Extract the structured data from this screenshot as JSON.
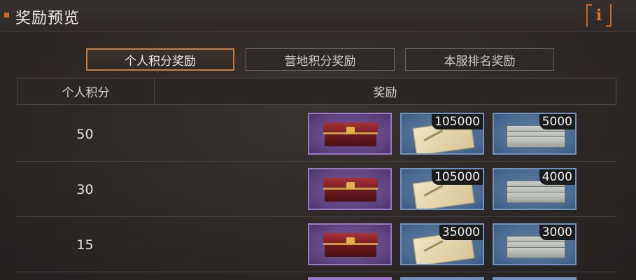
{
  "header": {
    "title": "奖励预览",
    "info_label": "i"
  },
  "tabs": [
    {
      "label": "个人积分奖励",
      "active": true
    },
    {
      "label": "营地积分奖励",
      "active": false
    },
    {
      "label": "本服排名奖励",
      "active": false
    }
  ],
  "table": {
    "headers": {
      "score": "个人积分",
      "reward": "奖励"
    },
    "rows": [
      {
        "score": "50",
        "rewards": [
          {
            "icon": "treasure-chest-icon",
            "quantity": ""
          },
          {
            "icon": "envelope-icon",
            "quantity": "105000"
          },
          {
            "icon": "cash-stack-icon",
            "quantity": "5000"
          }
        ]
      },
      {
        "score": "30",
        "rewards": [
          {
            "icon": "treasure-chest-icon",
            "quantity": ""
          },
          {
            "icon": "envelope-icon",
            "quantity": "105000"
          },
          {
            "icon": "cash-stack-icon",
            "quantity": "4000"
          }
        ]
      },
      {
        "score": "15",
        "rewards": [
          {
            "icon": "treasure-chest-icon",
            "quantity": ""
          },
          {
            "icon": "envelope-icon",
            "quantity": "35000"
          },
          {
            "icon": "cash-stack-icon",
            "quantity": "3000"
          }
        ]
      }
    ]
  },
  "colors": {
    "accent": "#d07a3a",
    "purple_frame": "#9a78c8",
    "blue_frame": "#6f93c0"
  }
}
